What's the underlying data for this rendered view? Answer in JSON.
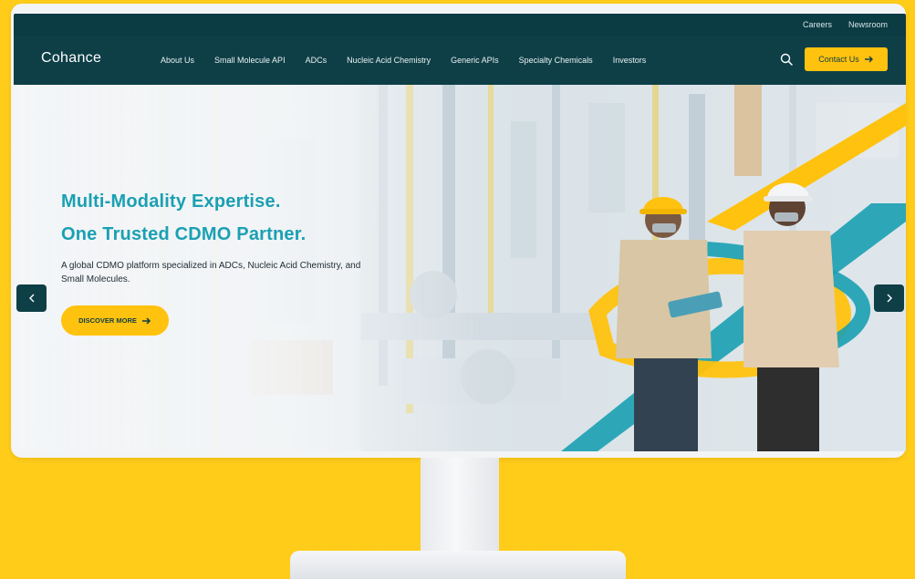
{
  "utility": {
    "links": [
      "Careers",
      "Newsroom"
    ]
  },
  "nav": {
    "logo": "Cohance",
    "items": [
      "About Us",
      "Small Molecule API",
      "ADCs",
      "Nucleic Acid Chemistry",
      "Generic APIs",
      "Specialty Chemicals",
      "Investors"
    ],
    "contact_label": "Contact Us"
  },
  "hero": {
    "title_line1": "Multi-Modality Expertise.",
    "title_line2": "One Trusted CDMO Partner.",
    "subtitle": "A global CDMO platform specialized in ADCs, Nucleic Acid Chemistry, and Small Molecules.",
    "cta_label": "DISCOVER MORE"
  },
  "colors": {
    "brand_dark": "#0e3f47",
    "accent_yellow": "#FFC20E",
    "accent_teal": "#1aa0b3",
    "background": "#FFCC1A"
  },
  "icons": [
    "search-icon",
    "arrow-right-icon",
    "chevron-left-icon",
    "chevron-right-icon"
  ]
}
